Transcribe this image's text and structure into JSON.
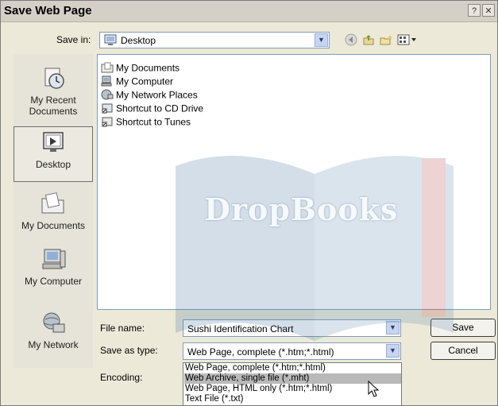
{
  "window": {
    "title": "Save Web Page",
    "help_glyph": "?",
    "close_glyph": "✕"
  },
  "toolbar": {
    "save_in_label": "Save in:",
    "save_in_value": "Desktop",
    "icons": [
      "back-icon",
      "up-folder-icon",
      "new-folder-icon",
      "views-menu-icon"
    ]
  },
  "places": [
    {
      "label": "My Recent Documents",
      "line1": "My Recent",
      "line2": "Documents",
      "icon": "recent-documents-icon"
    },
    {
      "label": "Desktop",
      "line1": "Desktop",
      "line2": "",
      "icon": "desktop-icon",
      "selected": true
    },
    {
      "label": "My Documents",
      "line1": "My Documents",
      "line2": "",
      "icon": "my-documents-icon"
    },
    {
      "label": "My Computer",
      "line1": "My Computer",
      "line2": "",
      "icon": "my-computer-icon"
    },
    {
      "label": "My Network",
      "line1": "My Network",
      "line2": "",
      "icon": "my-network-icon"
    }
  ],
  "files": [
    {
      "name": "My Documents",
      "icon": "folder-documents-icon"
    },
    {
      "name": "My Computer",
      "icon": "computer-icon"
    },
    {
      "name": "My Network Places",
      "icon": "network-places-icon"
    },
    {
      "name": "Shortcut to CD Drive",
      "icon": "shortcut-icon"
    },
    {
      "name": "Shortcut to Tunes",
      "icon": "shortcut-icon"
    }
  ],
  "form": {
    "file_name_label": "File name:",
    "file_name_value": "Sushi Identification Chart",
    "save_as_type_label": "Save as type:",
    "save_as_type_value": "Web Page, complete (*.htm;*.html)",
    "encoding_label": "Encoding:"
  },
  "buttons": {
    "save": "Save",
    "cancel": "Cancel"
  },
  "dropdown_options": [
    {
      "label": "Web Page, complete (*.htm;*.html)",
      "highlighted": false
    },
    {
      "label": "Web Archive, single file (*.mht)",
      "highlighted": true
    },
    {
      "label": "Web Page, HTML only (*.htm;*.html)",
      "highlighted": false
    },
    {
      "label": "Text File (*.txt)",
      "highlighted": false
    }
  ],
  "watermark": {
    "text": "DropBooks",
    "color": "#c8d8e8"
  }
}
